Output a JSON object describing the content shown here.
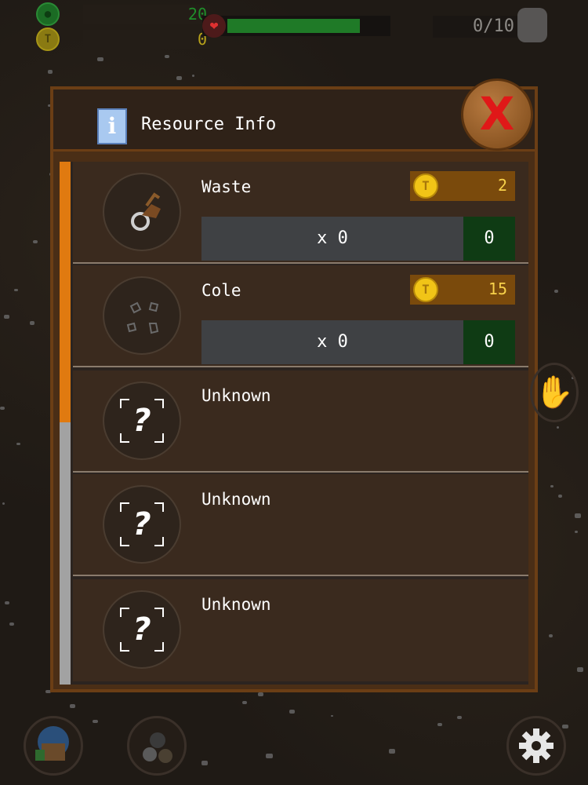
{
  "hud": {
    "gems": "20",
    "coins": "0",
    "health_fraction": 0.82,
    "bag_count": "0/10"
  },
  "panel": {
    "title": "Resource Info",
    "close_label": "X",
    "info_icon": "i"
  },
  "resources": [
    {
      "name": "Waste",
      "price": "2",
      "count": "x 0",
      "owned": "0",
      "icon": "waste-wheel-icon"
    },
    {
      "name": "Cole",
      "price": "15",
      "count": "x 0",
      "owned": "0",
      "icon": "coal-chunks-icon"
    },
    {
      "name": "Unknown",
      "icon": "question-icon"
    },
    {
      "name": "Unknown",
      "icon": "question-icon"
    },
    {
      "name": "Unknown",
      "icon": "question-icon"
    }
  ],
  "unknown_mark": "?",
  "colors": {
    "panel_border": "#6b3e15",
    "scroll_thumb": "#e07a10",
    "price_bg": "#7a4a0c",
    "owned_bg": "#0f3b14",
    "close_x": "#e01818"
  }
}
